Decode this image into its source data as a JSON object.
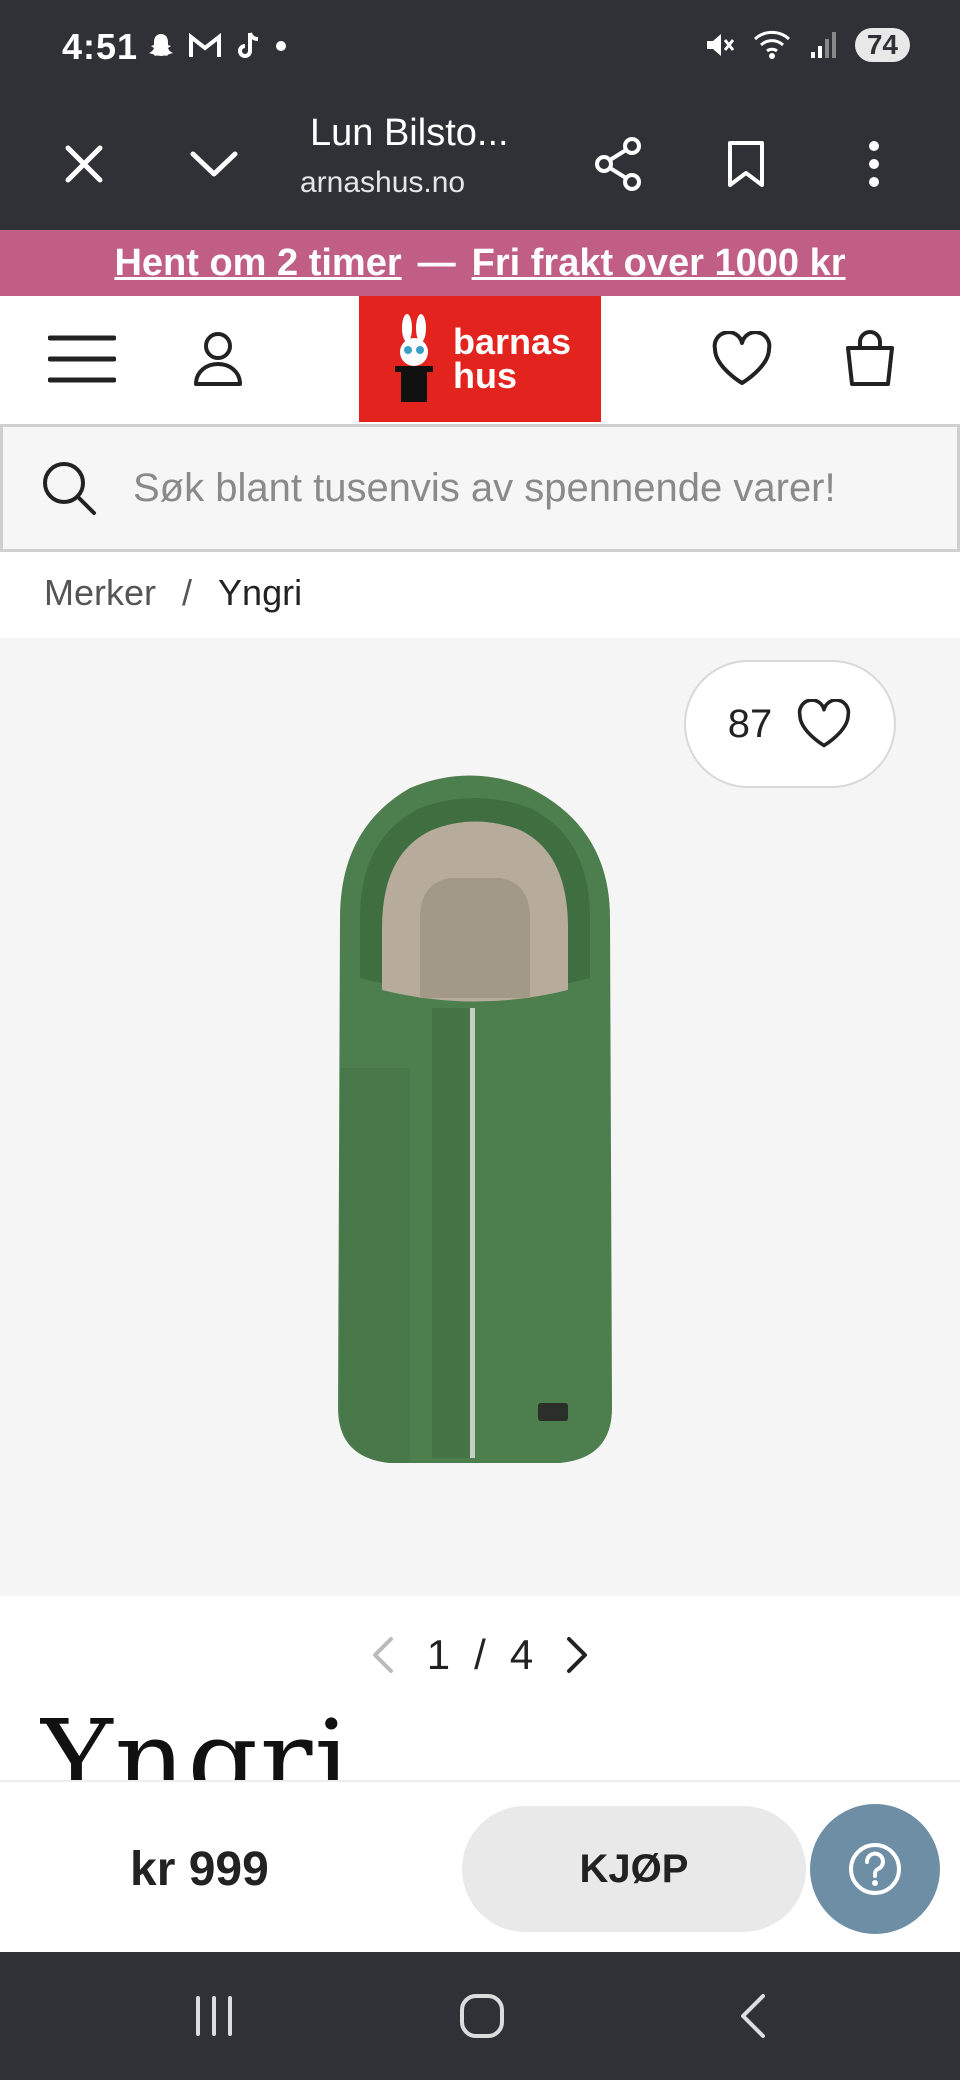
{
  "status": {
    "time": "4:51",
    "battery": "74"
  },
  "browser": {
    "title": "Lun Bilsto...",
    "url": "arnashus.no"
  },
  "promo": {
    "pickup": "Hent om 2 timer",
    "separator": "—",
    "shipping": "Fri frakt over 1000 kr"
  },
  "header": {
    "logo_line1": "barnas",
    "logo_line2": "hus"
  },
  "search": {
    "placeholder": "Søk blant tusenvis av spennende varer!"
  },
  "breadcrumb": {
    "items": [
      "Merker",
      "Yngri"
    ],
    "separator": "/"
  },
  "product": {
    "favorites_count": "87",
    "image_current": "1",
    "image_separator": "/",
    "image_total": "4",
    "brand": "Yngri",
    "price": "kr 999",
    "buy_label": "KJØP"
  },
  "colors": {
    "chrome": "#2f3136",
    "promo": "#c05e85",
    "logo_red": "#e3231e",
    "help": "#6e8ea6",
    "product_green": "#4a7a4a"
  }
}
